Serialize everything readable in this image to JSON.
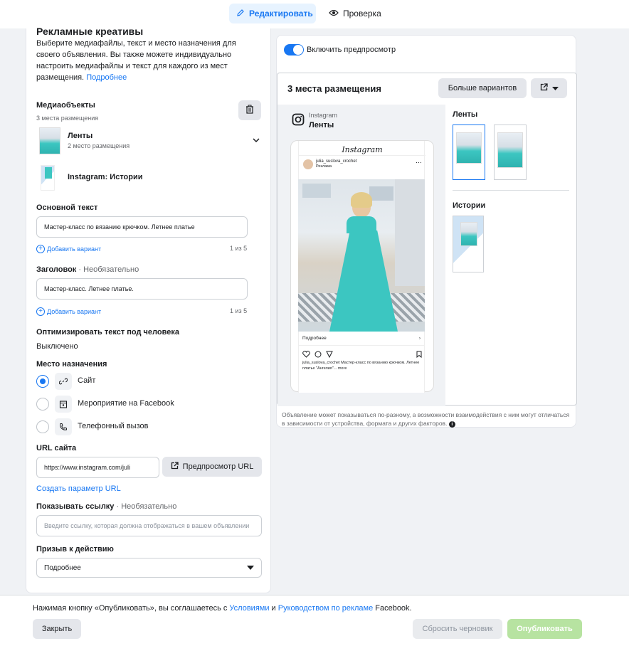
{
  "tabs": {
    "edit": "Редактировать",
    "review": "Проверка"
  },
  "creative": {
    "title": "Рекламные креативы",
    "desc": "Выберите медиафайлы, текст и место назначения для своего объявления. Вы также можете индивидуально настроить медиафайлы и текст для каждого из мест размещения.",
    "more_link": "Подробнее"
  },
  "media": {
    "label": "Медиаобъекты",
    "count": "3 места размещения",
    "feeds_title": "Ленты",
    "feeds_sub": "2 место размещения",
    "stories_title": "Instagram: Истории"
  },
  "primary_text": {
    "label": "Основной текст",
    "value": "Мастер-класс по вязанию крючком. Летнее платье",
    "add_variant": "Добавить вариант",
    "counter": "1 из 5"
  },
  "headline": {
    "label": "Заголовок",
    "optional": " · Необязательно",
    "value": "Мастер-класс. Летнее платье.",
    "add_variant": "Добавить вариант",
    "counter": "1 из 5"
  },
  "optimize": {
    "label": "Оптимизировать текст под человека",
    "value": "Выключено"
  },
  "destination": {
    "label": "Место назначения",
    "options": [
      "Сайт",
      "Мероприятие на Facebook",
      "Телефонный вызов"
    ],
    "selected": "Сайт"
  },
  "url": {
    "label": "URL сайта",
    "value": "https://www.instagram.com/juli",
    "preview_btn": "Предпросмотр URL",
    "param_link": "Создать параметр URL"
  },
  "display_link": {
    "label": "Показывать ссылку",
    "optional": " · Необязательно",
    "placeholder": "Введите ссылку, которая должна отображаться в вашем объявлении"
  },
  "cta": {
    "label": "Призыв к действию",
    "value": "Подробнее"
  },
  "preview": {
    "toggle_label": "Включить предпросмотр",
    "title": "3 места размещения",
    "more_variants": "Больше вариантов",
    "platform": "Instagram",
    "placement": "Ленты",
    "ig_logo": "Instagram",
    "account": "julia_suslova_crochet",
    "sponsored": "Реклама",
    "cta": "Подробнее",
    "caption": "julia_suslova_crochet Мастер-класс по вязанию крючком. Летнее платье \"Ангелия\"... more",
    "side_feeds": "Ленты",
    "side_stories": "Истории",
    "note": "Объявление может показываться по-разному, а возможности взаимодействия с ним могут отличаться в зависимости от устройства, формата и других факторов."
  },
  "footer": {
    "text_before": "Нажимая кнопку «Опубликовать», вы соглашаетесь с ",
    "terms": "Условиями",
    "and": " и ",
    "guide": "Руководством по рекламе",
    "text_after": " Facebook.",
    "close": "Закрыть",
    "reset": "Сбросить черновик",
    "publish": "Опубликовать"
  },
  "colors": {
    "accent": "#1877f2",
    "publish_disabled": "#b7e3a1",
    "dress": "#3cc6c1"
  }
}
